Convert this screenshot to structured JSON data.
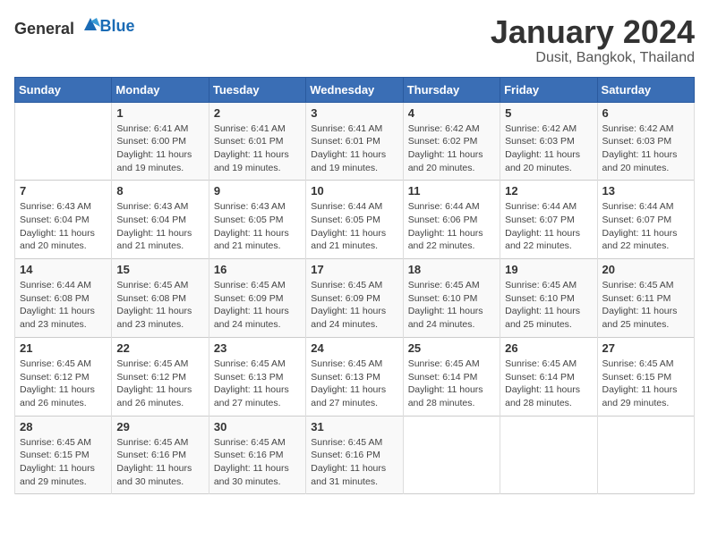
{
  "header": {
    "logo_general": "General",
    "logo_blue": "Blue",
    "month": "January 2024",
    "location": "Dusit, Bangkok, Thailand"
  },
  "weekdays": [
    "Sunday",
    "Monday",
    "Tuesday",
    "Wednesday",
    "Thursday",
    "Friday",
    "Saturday"
  ],
  "weeks": [
    [
      {
        "day": "",
        "info": ""
      },
      {
        "day": "1",
        "info": "Sunrise: 6:41 AM\nSunset: 6:00 PM\nDaylight: 11 hours\nand 19 minutes."
      },
      {
        "day": "2",
        "info": "Sunrise: 6:41 AM\nSunset: 6:01 PM\nDaylight: 11 hours\nand 19 minutes."
      },
      {
        "day": "3",
        "info": "Sunrise: 6:41 AM\nSunset: 6:01 PM\nDaylight: 11 hours\nand 19 minutes."
      },
      {
        "day": "4",
        "info": "Sunrise: 6:42 AM\nSunset: 6:02 PM\nDaylight: 11 hours\nand 20 minutes."
      },
      {
        "day": "5",
        "info": "Sunrise: 6:42 AM\nSunset: 6:03 PM\nDaylight: 11 hours\nand 20 minutes."
      },
      {
        "day": "6",
        "info": "Sunrise: 6:42 AM\nSunset: 6:03 PM\nDaylight: 11 hours\nand 20 minutes."
      }
    ],
    [
      {
        "day": "7",
        "info": "Sunrise: 6:43 AM\nSunset: 6:04 PM\nDaylight: 11 hours\nand 20 minutes."
      },
      {
        "day": "8",
        "info": "Sunrise: 6:43 AM\nSunset: 6:04 PM\nDaylight: 11 hours\nand 21 minutes."
      },
      {
        "day": "9",
        "info": "Sunrise: 6:43 AM\nSunset: 6:05 PM\nDaylight: 11 hours\nand 21 minutes."
      },
      {
        "day": "10",
        "info": "Sunrise: 6:44 AM\nSunset: 6:05 PM\nDaylight: 11 hours\nand 21 minutes."
      },
      {
        "day": "11",
        "info": "Sunrise: 6:44 AM\nSunset: 6:06 PM\nDaylight: 11 hours\nand 22 minutes."
      },
      {
        "day": "12",
        "info": "Sunrise: 6:44 AM\nSunset: 6:07 PM\nDaylight: 11 hours\nand 22 minutes."
      },
      {
        "day": "13",
        "info": "Sunrise: 6:44 AM\nSunset: 6:07 PM\nDaylight: 11 hours\nand 22 minutes."
      }
    ],
    [
      {
        "day": "14",
        "info": "Sunrise: 6:44 AM\nSunset: 6:08 PM\nDaylight: 11 hours\nand 23 minutes."
      },
      {
        "day": "15",
        "info": "Sunrise: 6:45 AM\nSunset: 6:08 PM\nDaylight: 11 hours\nand 23 minutes."
      },
      {
        "day": "16",
        "info": "Sunrise: 6:45 AM\nSunset: 6:09 PM\nDaylight: 11 hours\nand 24 minutes."
      },
      {
        "day": "17",
        "info": "Sunrise: 6:45 AM\nSunset: 6:09 PM\nDaylight: 11 hours\nand 24 minutes."
      },
      {
        "day": "18",
        "info": "Sunrise: 6:45 AM\nSunset: 6:10 PM\nDaylight: 11 hours\nand 24 minutes."
      },
      {
        "day": "19",
        "info": "Sunrise: 6:45 AM\nSunset: 6:10 PM\nDaylight: 11 hours\nand 25 minutes."
      },
      {
        "day": "20",
        "info": "Sunrise: 6:45 AM\nSunset: 6:11 PM\nDaylight: 11 hours\nand 25 minutes."
      }
    ],
    [
      {
        "day": "21",
        "info": "Sunrise: 6:45 AM\nSunset: 6:12 PM\nDaylight: 11 hours\nand 26 minutes."
      },
      {
        "day": "22",
        "info": "Sunrise: 6:45 AM\nSunset: 6:12 PM\nDaylight: 11 hours\nand 26 minutes."
      },
      {
        "day": "23",
        "info": "Sunrise: 6:45 AM\nSunset: 6:13 PM\nDaylight: 11 hours\nand 27 minutes."
      },
      {
        "day": "24",
        "info": "Sunrise: 6:45 AM\nSunset: 6:13 PM\nDaylight: 11 hours\nand 27 minutes."
      },
      {
        "day": "25",
        "info": "Sunrise: 6:45 AM\nSunset: 6:14 PM\nDaylight: 11 hours\nand 28 minutes."
      },
      {
        "day": "26",
        "info": "Sunrise: 6:45 AM\nSunset: 6:14 PM\nDaylight: 11 hours\nand 28 minutes."
      },
      {
        "day": "27",
        "info": "Sunrise: 6:45 AM\nSunset: 6:15 PM\nDaylight: 11 hours\nand 29 minutes."
      }
    ],
    [
      {
        "day": "28",
        "info": "Sunrise: 6:45 AM\nSunset: 6:15 PM\nDaylight: 11 hours\nand 29 minutes."
      },
      {
        "day": "29",
        "info": "Sunrise: 6:45 AM\nSunset: 6:16 PM\nDaylight: 11 hours\nand 30 minutes."
      },
      {
        "day": "30",
        "info": "Sunrise: 6:45 AM\nSunset: 6:16 PM\nDaylight: 11 hours\nand 30 minutes."
      },
      {
        "day": "31",
        "info": "Sunrise: 6:45 AM\nSunset: 6:16 PM\nDaylight: 11 hours\nand 31 minutes."
      },
      {
        "day": "",
        "info": ""
      },
      {
        "day": "",
        "info": ""
      },
      {
        "day": "",
        "info": ""
      }
    ]
  ]
}
